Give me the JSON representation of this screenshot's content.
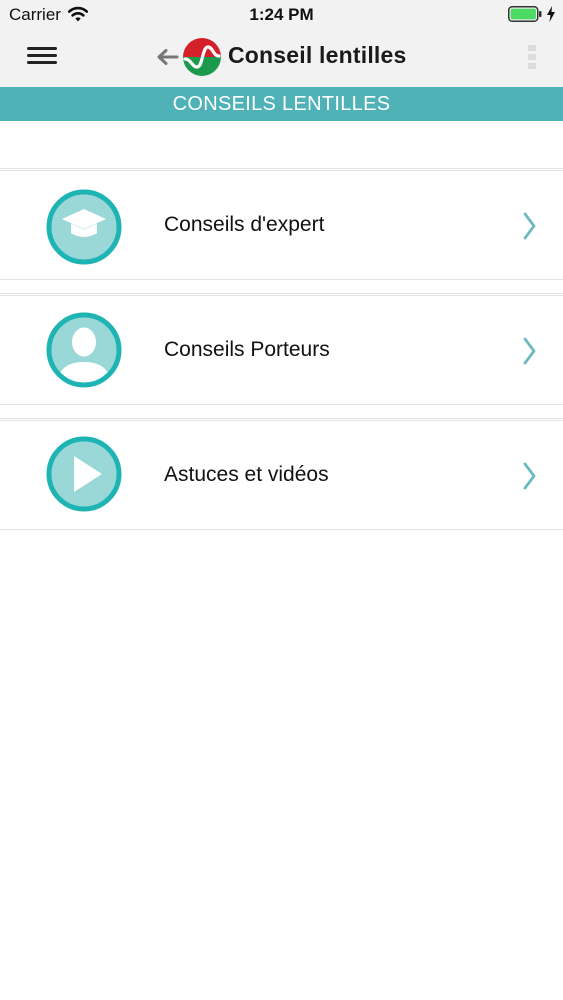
{
  "status_bar": {
    "carrier": "Carrier",
    "time": "1:24 PM",
    "battery_color": "#4cd964"
  },
  "header": {
    "title": "Conseil lentilles",
    "menu_icon": "hamburger-icon",
    "back_icon": "back-arrow-icon",
    "logo": "conseil-lentilles-logo",
    "more_icon": "kebab-icon"
  },
  "section": {
    "title": "CONSEILS LENTILLES",
    "color": "#4fb2b7"
  },
  "items": [
    {
      "label": "Conseils d'expert",
      "icon": "graduation-cap-icon"
    },
    {
      "label": "Conseils Porteurs",
      "icon": "user-silhouette-icon"
    },
    {
      "label": "Astuces et vidéos",
      "icon": "play-icon"
    }
  ],
  "colors": {
    "accent": "#1fb4b4",
    "icon_fill": "#9ad8d8",
    "chevron": "#6fb8bf"
  }
}
